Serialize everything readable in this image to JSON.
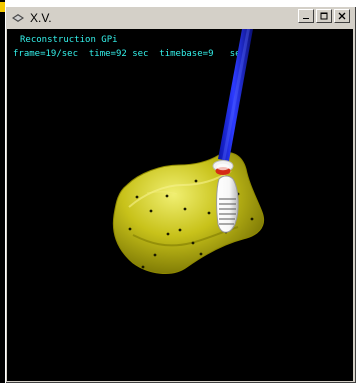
{
  "window": {
    "title": "X.V.",
    "controls": {
      "minimize_icon": "minimize-icon",
      "maximize_icon": "maximize-icon",
      "close_icon": "close-icon"
    }
  },
  "viewport": {
    "line1": "Reconstruction GPi",
    "line2": "frame=19/sec  time=92 sec  timebase=9   sec"
  },
  "colors": {
    "background": "#000000",
    "text": "#34F0EA",
    "structure": "#C8C21A",
    "probe": "#1F2BFF",
    "probe_tip_red": "#D42A16"
  }
}
